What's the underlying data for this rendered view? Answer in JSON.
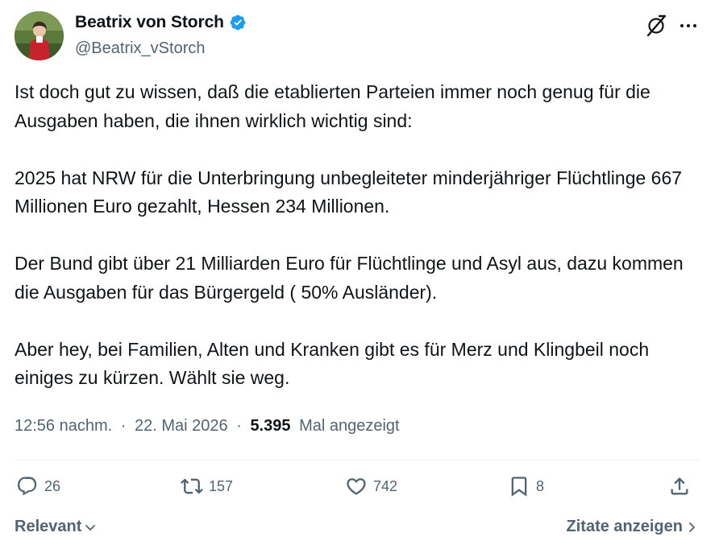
{
  "author": {
    "name": "Beatrix von Storch",
    "handle": "@Beatrix_vStorch",
    "verified_color": "#1d9bf0"
  },
  "icons": {
    "verified": "verified-badge-icon",
    "grok": "grok-icon",
    "more": "more-options-icon",
    "reply": "reply-icon",
    "retweet": "retweet-icon",
    "like": "like-icon",
    "bookmark": "bookmark-icon",
    "share": "share-icon"
  },
  "tweet": {
    "paragraphs": [
      "Ist doch gut zu wissen, daß die etablierten Parteien immer noch genug für die Ausgaben haben, die ihnen wirklich wichtig sind:",
      "2025 hat NRW für die Unterbringung unbegleiteter minderjähriger Flüchtlinge 667 Millionen Euro gezahlt, Hessen 234 Millionen.",
      "Der Bund gibt über 21 Milliarden Euro für Flüchtlinge und Asyl aus, dazu kommen die Ausgaben für das Bürgergeld ( 50% Ausländer).",
      "Aber hey, bei Familien, Alten und Kranken gibt es für Merz und Klingbeil noch einiges zu kürzen. Wählt sie weg."
    ]
  },
  "meta": {
    "time": "12:56 nachm.",
    "separator": "·",
    "date": "22. Mai 2026",
    "views_count": "5.395",
    "views_label": "Mal angezeigt"
  },
  "actions": {
    "replies": "26",
    "reposts": "157",
    "likes": "742",
    "bookmarks": "8"
  },
  "footer": {
    "sort_label": "Relevant",
    "quotes_label": "Zitate anzeigen"
  },
  "colors": {
    "text": "#0f1419",
    "secondary": "#536471",
    "divider": "#eff3f4"
  }
}
